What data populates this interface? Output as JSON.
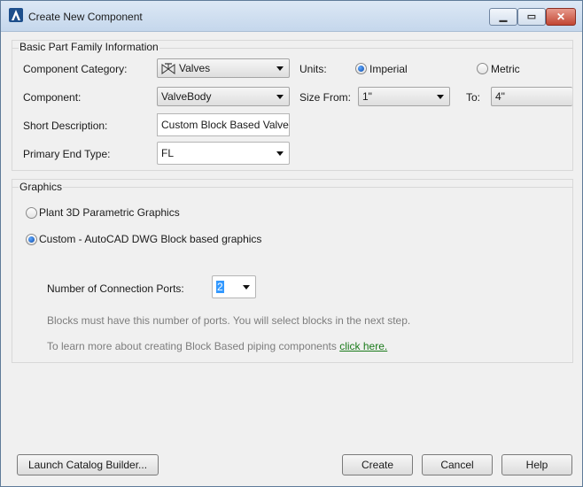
{
  "window": {
    "title": "Create New Component"
  },
  "basic_group": {
    "title": "Basic Part Family Information",
    "component_category": {
      "label": "Component Category:",
      "value": "Valves",
      "icon": "valve-icon"
    },
    "component": {
      "label": "Component:",
      "value": "ValveBody"
    },
    "short_description": {
      "label": "Short Description:",
      "value": "Custom Block Based Valve"
    },
    "primary_end_type": {
      "label": "Primary End Type:",
      "value": "FL"
    },
    "units": {
      "label": "Units:",
      "options": [
        "Imperial",
        "Metric"
      ],
      "selected": "Imperial"
    },
    "size_from": {
      "label": "Size From:",
      "value": "1\""
    },
    "size_to": {
      "label": "To:",
      "value": "4\""
    }
  },
  "graphics_group": {
    "title": "Graphics",
    "option_parametric": "Plant 3D Parametric Graphics",
    "option_custom": "Custom - AutoCAD DWG Block based graphics",
    "selected": "custom",
    "ports": {
      "label": "Number of Connection Ports:",
      "value": "2"
    },
    "hint_blocks": "Blocks must have this number of ports. You will select blocks in the next step.",
    "hint_learn": "To learn more about creating Block Based piping components",
    "link_text": "click here."
  },
  "footer": {
    "launch_label": "Launch Catalog Builder...",
    "create_label": "Create",
    "cancel_label": "Cancel",
    "help_label": "Help"
  },
  "colors": {
    "accent": "#0b4aa8",
    "link": "#1a7a1a",
    "close_button": "#c24734"
  }
}
